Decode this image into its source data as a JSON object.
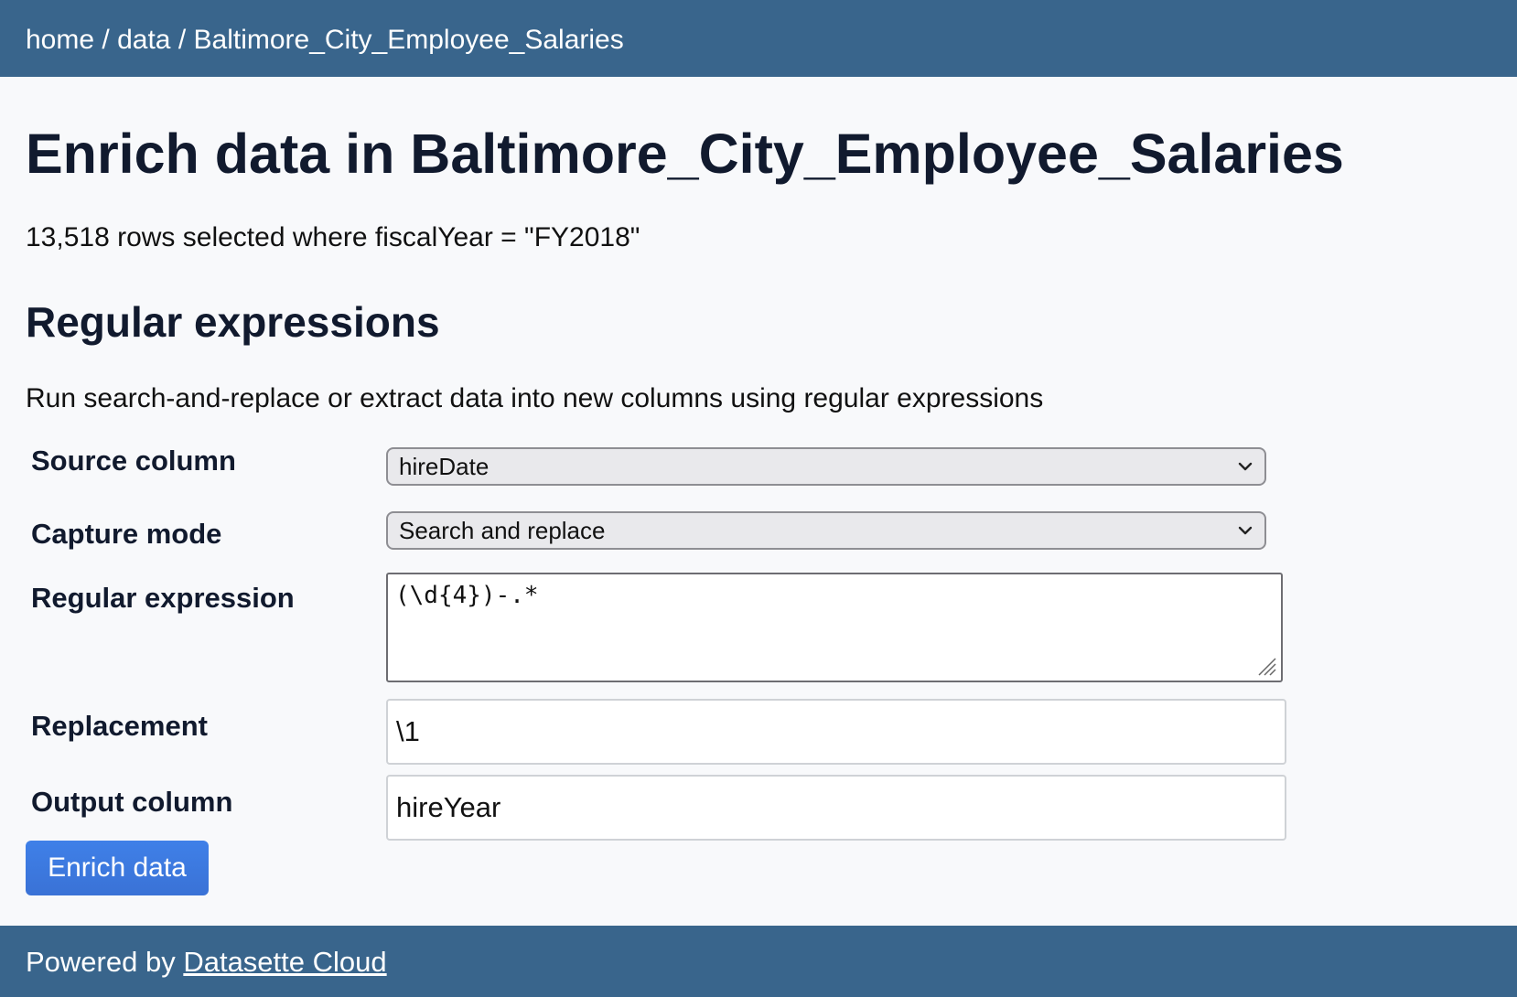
{
  "breadcrumb": {
    "home": "home",
    "sep1": "/",
    "data": "data",
    "sep2": "/",
    "table": "Baltimore_City_Employee_Salaries"
  },
  "page": {
    "title": "Enrich data in Baltimore_City_Employee_Salaries",
    "selection_info": "13,518 rows selected where fiscalYear = \"FY2018\""
  },
  "section": {
    "title": "Regular expressions",
    "description": "Run search-and-replace or extract data into new columns using regular expressions"
  },
  "form": {
    "source_column": {
      "label": "Source column",
      "value": "hireDate"
    },
    "capture_mode": {
      "label": "Capture mode",
      "value": "Search and replace"
    },
    "regular_expression": {
      "label": "Regular expression",
      "value": "(\\d{4})-.*"
    },
    "replacement": {
      "label": "Replacement",
      "value": "\\1"
    },
    "output_column": {
      "label": "Output column",
      "value": "hireYear"
    },
    "submit_label": "Enrich data"
  },
  "footer": {
    "prefix": "Powered by ",
    "link_text": "Datasette Cloud"
  },
  "colors": {
    "header_bg": "#39658c",
    "button_bg": "#3b76de",
    "page_bg": "#f8f9fb"
  },
  "icons": {
    "select_arrow": "chevron-down-icon",
    "textarea_resize": "resize-handle-icon"
  }
}
